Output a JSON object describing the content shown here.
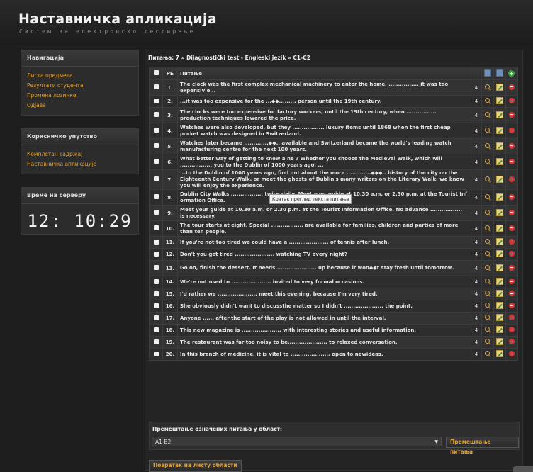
{
  "app": {
    "title": "Наставничка апликација",
    "subtitle": "Систем за електронско тестирање"
  },
  "navigation": {
    "heading": "Навигација",
    "items": [
      {
        "label": "Листа предмета"
      },
      {
        "label": "Резултати студента"
      },
      {
        "label": "Промена лозинке"
      },
      {
        "label": "Одјава"
      }
    ]
  },
  "manual": {
    "heading": "Корисничко упутство",
    "items": [
      {
        "label": "Комплетан садржај"
      },
      {
        "label": "Наставничка апликација"
      }
    ]
  },
  "server_time": {
    "heading": "Време на серверу",
    "value": "12: 10:29"
  },
  "breadcrumb": "Питања: 7 » Dijagnostički test - Engleski jezik » C1-C2",
  "table": {
    "col_num": "РБ",
    "col_question": "Питање",
    "rows": [
      {
        "num": "1.",
        "text": "The clock was the first complex mechanical machinery to enter the home, ................ it was too expensiv e...",
        "level": "4"
      },
      {
        "num": "2.",
        "text": "...it was too expensive for the ...◆◆......... person until the 19th century,",
        "level": "4"
      },
      {
        "num": "3.",
        "text": "The clocks were too expensive for factory workers, until the 19th century, when ................ production techniques lowered the price.",
        "level": "4"
      },
      {
        "num": "4.",
        "text": "Watches were also developed, but they ................. luxury items until 1868 when the first cheap pocket watch was designed in Switzerland.",
        "level": "4"
      },
      {
        "num": "5.",
        "text": "Watches later became .............◆◆.. available and Switzerland became the world's leading watch manufacturing centre for the next 100 years.",
        "level": "4"
      },
      {
        "num": "6.",
        "text": "What better way of getting to know a ne                                  ? Whether you choose the Medieval Walk, which will ................. you to the Dublin of 1000 years ago, ...",
        "level": "4"
      },
      {
        "num": "7.",
        "text": "...to the Dublin of 1000 years ago, find out about the more .............◆◆◆.. history of the city on the Eighteenth Century Walk, or meet the ghosts of Dublin's many writers on the Literary Walk, we know you will enjoy the experience.",
        "level": "4"
      },
      {
        "num": "8.",
        "text": "Dublin City Walks ................. twice daily. Meet your guide at 10.30 a.m. or 2.30 p.m. at the Tourist Inf ormation Office.",
        "level": "4"
      },
      {
        "num": "9.",
        "text": "Meet your guide at 10.30 a.m. or 2.30 p.m. at the Tourist Information Office. No advance ................. is necessary.",
        "level": "4"
      },
      {
        "num": "10.",
        "text": "The tour starts at eight. Special ................. are available for families, children and parties of more than ten people.",
        "level": "4"
      },
      {
        "num": "11.",
        "text": "If you're not too tired we could have a ..................... of tennis after lunch.",
        "level": "4"
      },
      {
        "num": "12.",
        "text": "Don't you get tired ..................... watching TV every night?",
        "level": "4"
      },
      {
        "num": "13.",
        "text": "Go on, finish the dessert. It needs ..................... up because it won◆◆t stay fresh until tomorrow.",
        "level": "4"
      },
      {
        "num": "14.",
        "text": "We're not used to ..................... invited to very formal occasions.",
        "level": "4"
      },
      {
        "num": "15.",
        "text": "I'd rather we ..................... meet this evening, because I'm very tired.",
        "level": "4"
      },
      {
        "num": "16.",
        "text": "She obviously didn't want to discussthe matter so I didn't ..................... the point.",
        "level": "4"
      },
      {
        "num": "17.",
        "text": "Anyone ...... after the start of the play is not allowed in until the interval.",
        "level": "4"
      },
      {
        "num": "18.",
        "text": "This new magazine is ..................... with interesting stories and useful information.",
        "level": "4"
      },
      {
        "num": "19.",
        "text": "The restaurant was far too noisy to be..................... to relaxed conversation.",
        "level": "4"
      },
      {
        "num": "20.",
        "text": "In this branch of medicine, it is vital to ..................... open to newideas.",
        "level": "4"
      }
    ]
  },
  "tooltip": "Кратак преглед текста питања",
  "move_section": {
    "label": "Премештање означених питања у област:",
    "selected": "A1-B2",
    "button": "Премештање питања"
  },
  "back_button": "Повратак на листу области",
  "icons": {
    "view": "magnifier-icon",
    "edit": "edit-icon",
    "delete": "delete-icon",
    "add": "add-icon",
    "save": "disk-icon"
  },
  "colors": {
    "link": "#e4a12e",
    "background": "#1e1e1e",
    "panel": "#2c2c2c"
  }
}
